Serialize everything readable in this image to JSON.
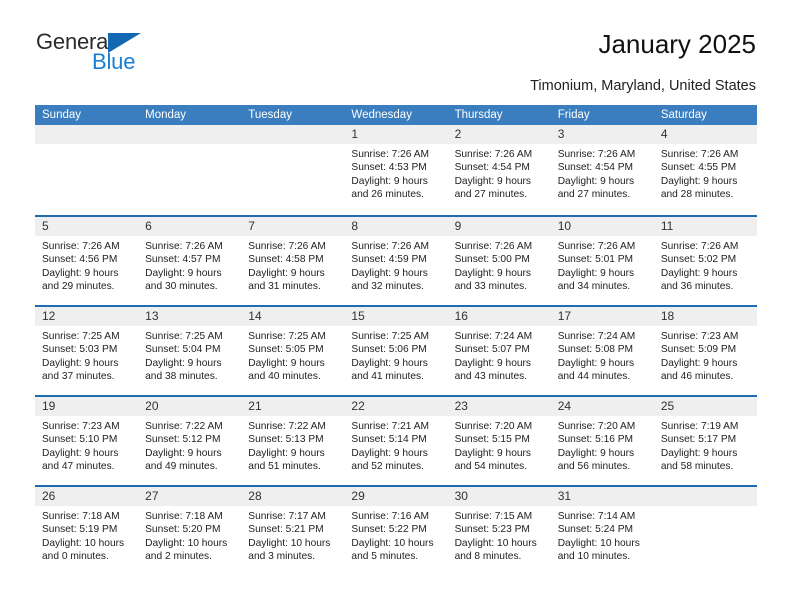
{
  "logo": {
    "line1": "General",
    "line2": "Blue",
    "triangle_color": "#1268b3",
    "blue_text_color": "#1a7fd4"
  },
  "header": {
    "title": "January 2025",
    "subtitle": "Timonium, Maryland, United States"
  },
  "calendar": {
    "header_bg": "#3a7ebf",
    "row_divider_color": "#1f6cb0",
    "daynum_band_color": "#efefef",
    "weekdays": [
      "Sunday",
      "Monday",
      "Tuesday",
      "Wednesday",
      "Thursday",
      "Friday",
      "Saturday"
    ],
    "weeks": [
      [
        {
          "day": "",
          "sunrise": "",
          "sunset": "",
          "daylight1": "",
          "daylight2": ""
        },
        {
          "day": "",
          "sunrise": "",
          "sunset": "",
          "daylight1": "",
          "daylight2": ""
        },
        {
          "day": "",
          "sunrise": "",
          "sunset": "",
          "daylight1": "",
          "daylight2": ""
        },
        {
          "day": "1",
          "sunrise": "Sunrise: 7:26 AM",
          "sunset": "Sunset: 4:53 PM",
          "daylight1": "Daylight: 9 hours",
          "daylight2": "and 26 minutes."
        },
        {
          "day": "2",
          "sunrise": "Sunrise: 7:26 AM",
          "sunset": "Sunset: 4:54 PM",
          "daylight1": "Daylight: 9 hours",
          "daylight2": "and 27 minutes."
        },
        {
          "day": "3",
          "sunrise": "Sunrise: 7:26 AM",
          "sunset": "Sunset: 4:54 PM",
          "daylight1": "Daylight: 9 hours",
          "daylight2": "and 27 minutes."
        },
        {
          "day": "4",
          "sunrise": "Sunrise: 7:26 AM",
          "sunset": "Sunset: 4:55 PM",
          "daylight1": "Daylight: 9 hours",
          "daylight2": "and 28 minutes."
        }
      ],
      [
        {
          "day": "5",
          "sunrise": "Sunrise: 7:26 AM",
          "sunset": "Sunset: 4:56 PM",
          "daylight1": "Daylight: 9 hours",
          "daylight2": "and 29 minutes."
        },
        {
          "day": "6",
          "sunrise": "Sunrise: 7:26 AM",
          "sunset": "Sunset: 4:57 PM",
          "daylight1": "Daylight: 9 hours",
          "daylight2": "and 30 minutes."
        },
        {
          "day": "7",
          "sunrise": "Sunrise: 7:26 AM",
          "sunset": "Sunset: 4:58 PM",
          "daylight1": "Daylight: 9 hours",
          "daylight2": "and 31 minutes."
        },
        {
          "day": "8",
          "sunrise": "Sunrise: 7:26 AM",
          "sunset": "Sunset: 4:59 PM",
          "daylight1": "Daylight: 9 hours",
          "daylight2": "and 32 minutes."
        },
        {
          "day": "9",
          "sunrise": "Sunrise: 7:26 AM",
          "sunset": "Sunset: 5:00 PM",
          "daylight1": "Daylight: 9 hours",
          "daylight2": "and 33 minutes."
        },
        {
          "day": "10",
          "sunrise": "Sunrise: 7:26 AM",
          "sunset": "Sunset: 5:01 PM",
          "daylight1": "Daylight: 9 hours",
          "daylight2": "and 34 minutes."
        },
        {
          "day": "11",
          "sunrise": "Sunrise: 7:26 AM",
          "sunset": "Sunset: 5:02 PM",
          "daylight1": "Daylight: 9 hours",
          "daylight2": "and 36 minutes."
        }
      ],
      [
        {
          "day": "12",
          "sunrise": "Sunrise: 7:25 AM",
          "sunset": "Sunset: 5:03 PM",
          "daylight1": "Daylight: 9 hours",
          "daylight2": "and 37 minutes."
        },
        {
          "day": "13",
          "sunrise": "Sunrise: 7:25 AM",
          "sunset": "Sunset: 5:04 PM",
          "daylight1": "Daylight: 9 hours",
          "daylight2": "and 38 minutes."
        },
        {
          "day": "14",
          "sunrise": "Sunrise: 7:25 AM",
          "sunset": "Sunset: 5:05 PM",
          "daylight1": "Daylight: 9 hours",
          "daylight2": "and 40 minutes."
        },
        {
          "day": "15",
          "sunrise": "Sunrise: 7:25 AM",
          "sunset": "Sunset: 5:06 PM",
          "daylight1": "Daylight: 9 hours",
          "daylight2": "and 41 minutes."
        },
        {
          "day": "16",
          "sunrise": "Sunrise: 7:24 AM",
          "sunset": "Sunset: 5:07 PM",
          "daylight1": "Daylight: 9 hours",
          "daylight2": "and 43 minutes."
        },
        {
          "day": "17",
          "sunrise": "Sunrise: 7:24 AM",
          "sunset": "Sunset: 5:08 PM",
          "daylight1": "Daylight: 9 hours",
          "daylight2": "and 44 minutes."
        },
        {
          "day": "18",
          "sunrise": "Sunrise: 7:23 AM",
          "sunset": "Sunset: 5:09 PM",
          "daylight1": "Daylight: 9 hours",
          "daylight2": "and 46 minutes."
        }
      ],
      [
        {
          "day": "19",
          "sunrise": "Sunrise: 7:23 AM",
          "sunset": "Sunset: 5:10 PM",
          "daylight1": "Daylight: 9 hours",
          "daylight2": "and 47 minutes."
        },
        {
          "day": "20",
          "sunrise": "Sunrise: 7:22 AM",
          "sunset": "Sunset: 5:12 PM",
          "daylight1": "Daylight: 9 hours",
          "daylight2": "and 49 minutes."
        },
        {
          "day": "21",
          "sunrise": "Sunrise: 7:22 AM",
          "sunset": "Sunset: 5:13 PM",
          "daylight1": "Daylight: 9 hours",
          "daylight2": "and 51 minutes."
        },
        {
          "day": "22",
          "sunrise": "Sunrise: 7:21 AM",
          "sunset": "Sunset: 5:14 PM",
          "daylight1": "Daylight: 9 hours",
          "daylight2": "and 52 minutes."
        },
        {
          "day": "23",
          "sunrise": "Sunrise: 7:20 AM",
          "sunset": "Sunset: 5:15 PM",
          "daylight1": "Daylight: 9 hours",
          "daylight2": "and 54 minutes."
        },
        {
          "day": "24",
          "sunrise": "Sunrise: 7:20 AM",
          "sunset": "Sunset: 5:16 PM",
          "daylight1": "Daylight: 9 hours",
          "daylight2": "and 56 minutes."
        },
        {
          "day": "25",
          "sunrise": "Sunrise: 7:19 AM",
          "sunset": "Sunset: 5:17 PM",
          "daylight1": "Daylight: 9 hours",
          "daylight2": "and 58 minutes."
        }
      ],
      [
        {
          "day": "26",
          "sunrise": "Sunrise: 7:18 AM",
          "sunset": "Sunset: 5:19 PM",
          "daylight1": "Daylight: 10 hours",
          "daylight2": "and 0 minutes."
        },
        {
          "day": "27",
          "sunrise": "Sunrise: 7:18 AM",
          "sunset": "Sunset: 5:20 PM",
          "daylight1": "Daylight: 10 hours",
          "daylight2": "and 2 minutes."
        },
        {
          "day": "28",
          "sunrise": "Sunrise: 7:17 AM",
          "sunset": "Sunset: 5:21 PM",
          "daylight1": "Daylight: 10 hours",
          "daylight2": "and 3 minutes."
        },
        {
          "day": "29",
          "sunrise": "Sunrise: 7:16 AM",
          "sunset": "Sunset: 5:22 PM",
          "daylight1": "Daylight: 10 hours",
          "daylight2": "and 5 minutes."
        },
        {
          "day": "30",
          "sunrise": "Sunrise: 7:15 AM",
          "sunset": "Sunset: 5:23 PM",
          "daylight1": "Daylight: 10 hours",
          "daylight2": "and 8 minutes."
        },
        {
          "day": "31",
          "sunrise": "Sunrise: 7:14 AM",
          "sunset": "Sunset: 5:24 PM",
          "daylight1": "Daylight: 10 hours",
          "daylight2": "and 10 minutes."
        },
        {
          "day": "",
          "sunrise": "",
          "sunset": "",
          "daylight1": "",
          "daylight2": ""
        }
      ]
    ]
  }
}
